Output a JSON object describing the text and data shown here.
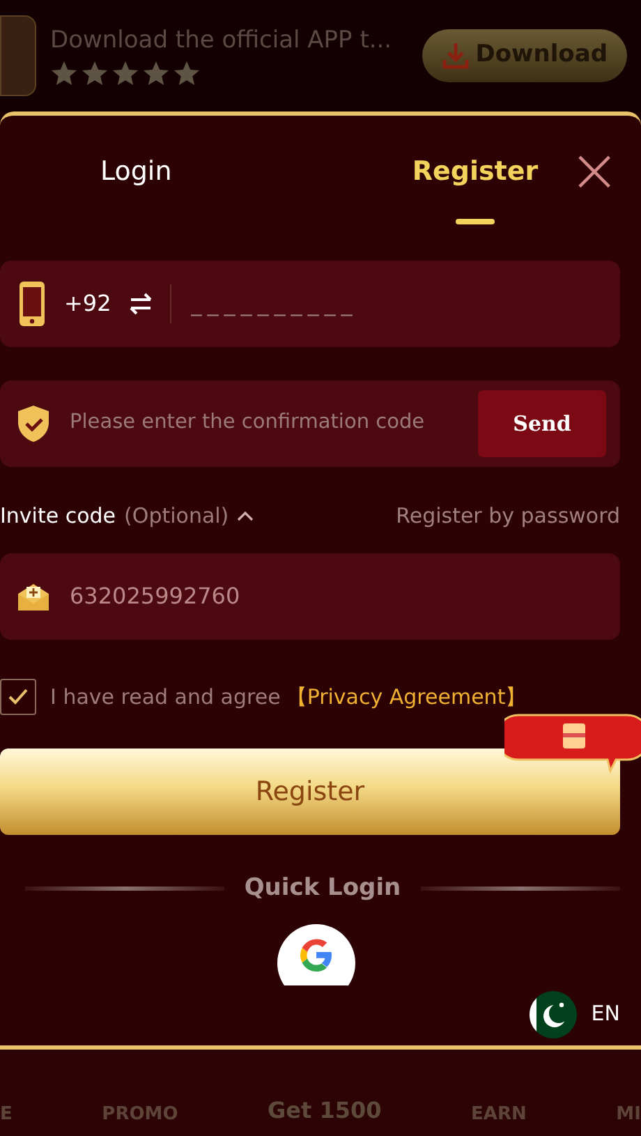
{
  "banner": {
    "text": "Download the official APP t...",
    "stars": 5,
    "button": "Download"
  },
  "tabs": [
    {
      "label": "Login",
      "selected": false
    },
    {
      "label": "Register",
      "selected": true
    }
  ],
  "close": "×",
  "phone": {
    "code": "+92",
    "placeholder": "__________"
  },
  "confirm": {
    "placeholder": "Please enter the confirmation code",
    "button": "Send"
  },
  "invite": {
    "label": "Invite code",
    "hint": "(Optional)",
    "expanded": true,
    "alt_link": "Register by password",
    "value": "632025992760"
  },
  "agree": {
    "checked": true,
    "text": "I have read and agree",
    "link": "【Privacy Agreement】"
  },
  "submit": "Register",
  "quick_login": "Quick Login",
  "language": "EN",
  "bottom_nav": [
    {
      "label": "E"
    },
    {
      "label": "PROMO"
    },
    {
      "label": "Get 1500"
    },
    {
      "label": "EARN"
    },
    {
      "label": "MI"
    }
  ]
}
